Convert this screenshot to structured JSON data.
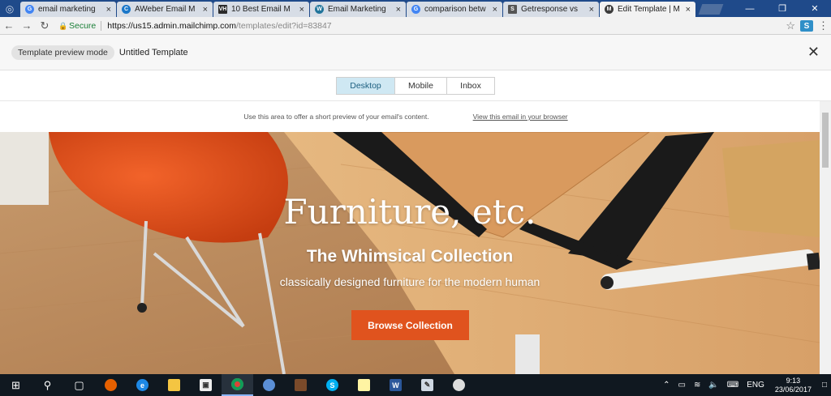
{
  "browser": {
    "tabs": [
      {
        "title": "email marketing",
        "favicon": "google-icon",
        "color": "#4285f4",
        "active": false
      },
      {
        "title": "AWeber Email M",
        "favicon": "aweber-icon",
        "color": "#1a77c9",
        "active": false
      },
      {
        "title": "10 Best Email M",
        "favicon": "vh-icon",
        "color": "#2b2b2b",
        "active": false
      },
      {
        "title": "Email Marketing",
        "favicon": "wordpress-icon",
        "color": "#21759b",
        "active": false
      },
      {
        "title": "comparison betw",
        "favicon": "google-icon",
        "color": "#4285f4",
        "active": false
      },
      {
        "title": "Getresponse vs",
        "favicon": "s-icon",
        "color": "#555555",
        "active": false
      },
      {
        "title": "Edit Template | M",
        "favicon": "mailchimp-icon",
        "color": "#3c3c3c",
        "active": true
      }
    ],
    "address": {
      "secure_label": "Secure",
      "url_host": "https://us15.admin.mailchimp.com",
      "url_path": "/templates/edit?id=83847"
    }
  },
  "preview": {
    "mode_label": "Template preview mode",
    "template_name": "Untitled Template",
    "views": [
      "Desktop",
      "Mobile",
      "Inbox"
    ],
    "selected_view": "Desktop"
  },
  "email": {
    "preheader_text": "Use this area to offer a short preview of your email's content.",
    "browser_link": "View this email in your browser",
    "hero_title": "Furniture, etc.",
    "hero_subtitle": "The Whimsical Collection",
    "hero_tagline": "classically designed furniture for the modern human",
    "cta_label": "Browse Collection"
  },
  "taskbar": {
    "language": "ENG",
    "time": "9:13",
    "date": "23/06/2017"
  },
  "colors": {
    "accent": "#e0531e",
    "selected_tab": "#cfe8f3"
  }
}
